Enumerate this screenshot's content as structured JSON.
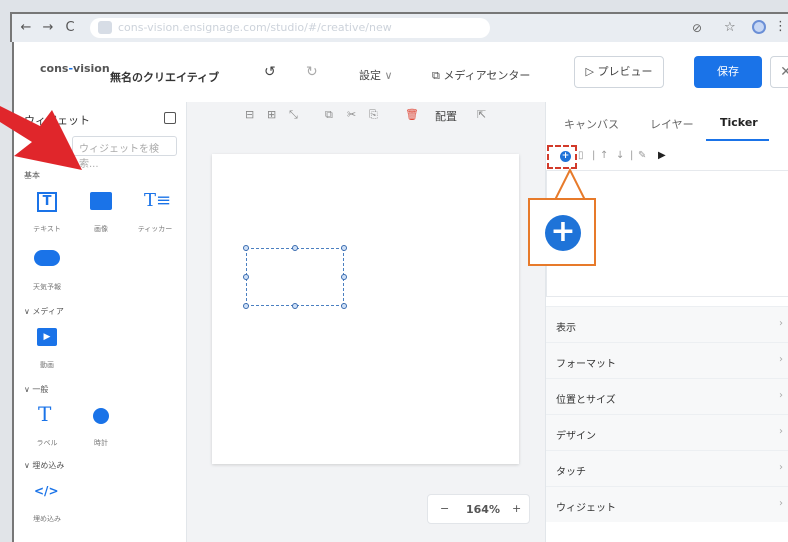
{
  "browser": {
    "url": "cons-vision.ensignage.com/studio/#/creative/new",
    "nav": [
      "←",
      "→",
      "C"
    ]
  },
  "app": {
    "logo_left": "cons",
    "logo_dash": "-",
    "logo_right": "vision",
    "title": "無名のクリエイティブ",
    "undo": "↺",
    "redo": "↻",
    "settings": "設定",
    "settings_caret": "∨",
    "media_center": "メディアセンター",
    "preview": "▷ プレビュー",
    "save": "保存",
    "close": "✕"
  },
  "widgets_panel": {
    "title": "ウィジェット",
    "search_placeholder": "ウィジェットを検索...",
    "sections": [
      {
        "label": "基本",
        "items": [
          {
            "label": "テキスト",
            "icon": "text-icon"
          },
          {
            "label": "画像",
            "icon": "image-icon"
          },
          {
            "label": "ティッカー",
            "icon": "ticker-icon"
          },
          {
            "label": "天気予報",
            "icon": "weather-icon"
          }
        ]
      },
      {
        "label": "メディア",
        "items": [
          {
            "label": "動画",
            "icon": "video-icon"
          }
        ]
      },
      {
        "label": "一般",
        "items": [
          {
            "label": "ラベル",
            "icon": "label-icon"
          },
          {
            "label": "時計",
            "icon": "clock-icon"
          }
        ]
      },
      {
        "label": "埋め込み",
        "items": [
          {
            "label": "埋め込み",
            "icon": "embed-icon"
          }
        ]
      }
    ]
  },
  "canvas": {
    "align_label": "配置",
    "zoom": "164%",
    "zoom_minus": "−",
    "zoom_plus": "+"
  },
  "right_panel": {
    "tabs": [
      {
        "label": "キャンバス"
      },
      {
        "label": "レイヤー"
      },
      {
        "label": "Ticker"
      }
    ],
    "active_tab": "Ticker",
    "sections": [
      "表示",
      "フォーマット",
      "位置とサイズ",
      "デザイン",
      "タッチ",
      "ウィジェット"
    ]
  },
  "colors": {
    "accent": "#1a73e8",
    "annotation_red": "#d23a2a",
    "annotation_orange": "#e77a2a"
  }
}
